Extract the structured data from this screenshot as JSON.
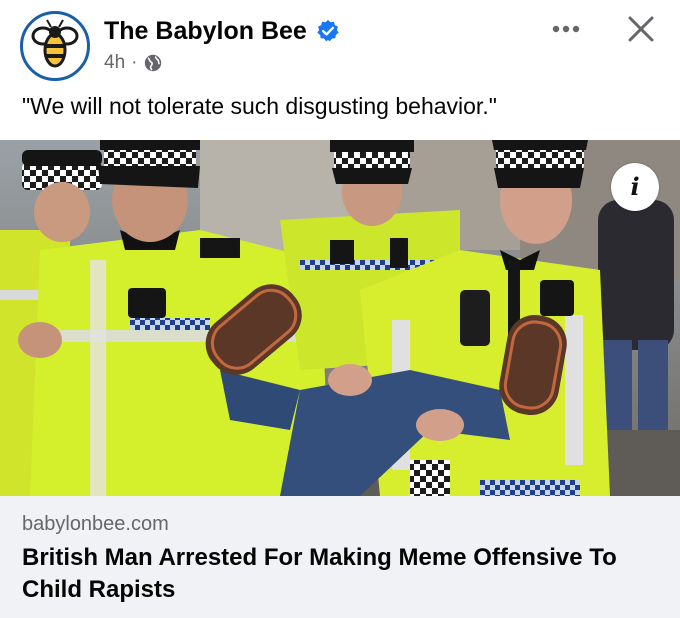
{
  "post": {
    "page_name": "The Babylon Bee",
    "timestamp": "4h",
    "separator": "·",
    "caption": "\"We will not tolerate such disgusting behavior.\""
  },
  "icons": {
    "avatar": "babylon-bee-logo",
    "verified": "verified-badge-icon",
    "privacy": "globe-icon",
    "more": "more-options-icon",
    "close": "close-icon",
    "info": "info-icon"
  },
  "info_label": "i",
  "link": {
    "domain": "babylonbee.com",
    "title": "British Man Arrested For Making Meme Offensive To Child Rapists"
  },
  "colors": {
    "verified": "#1877f2",
    "logo_ring": "#1a5fa8",
    "logo_bee": "#f6c33b",
    "hi_vis": "#d4ef2c",
    "link_bg": "#f0f2f5",
    "secondary_text": "#65676b"
  }
}
